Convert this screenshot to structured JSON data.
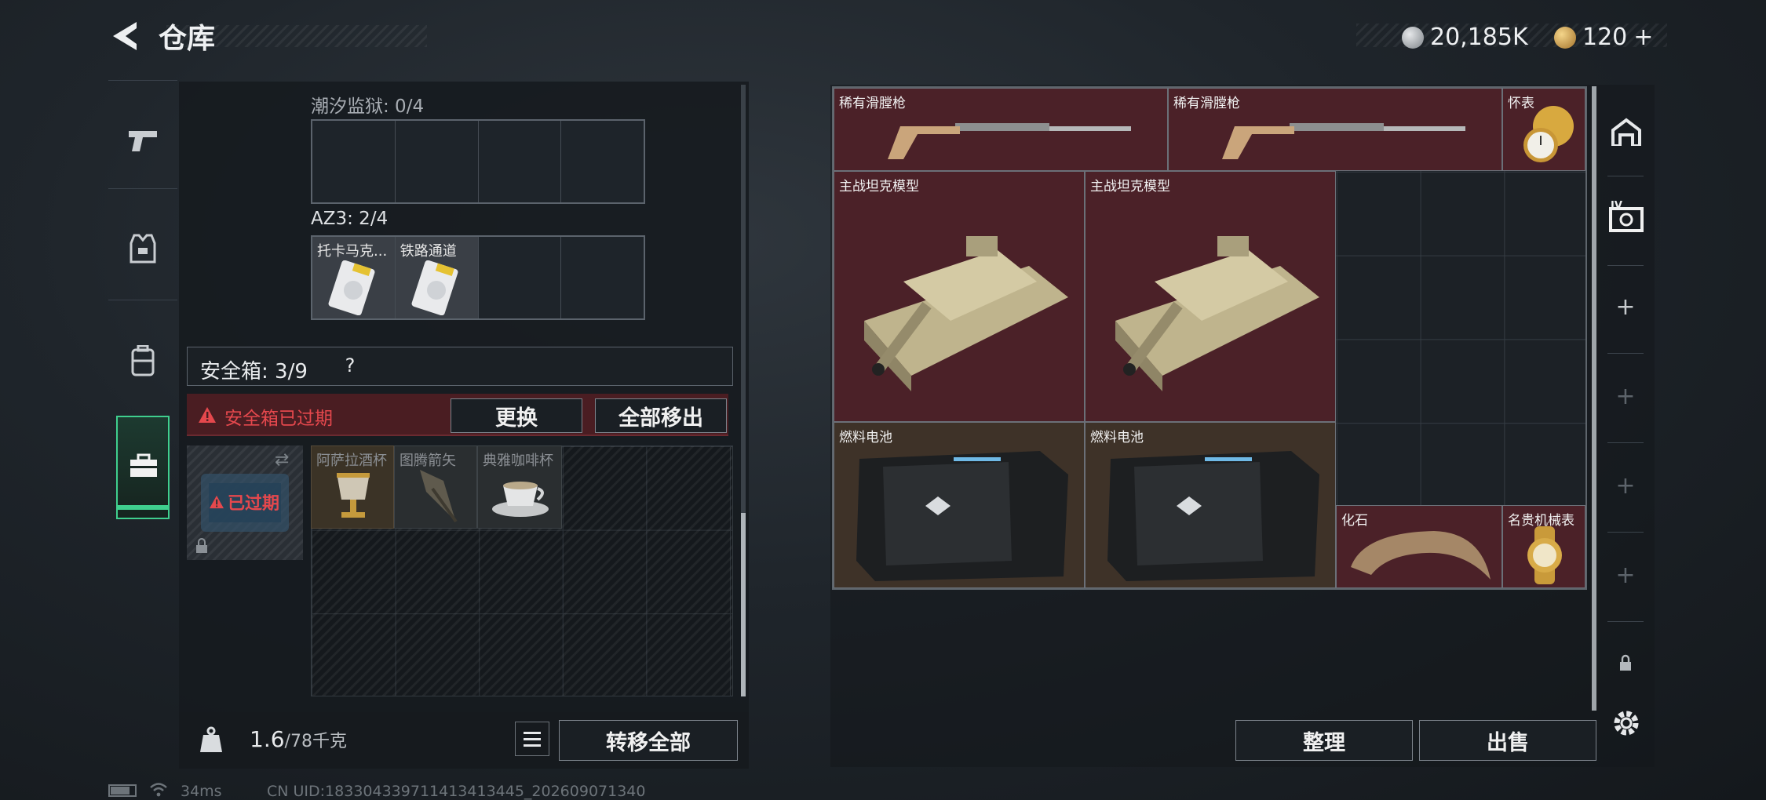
{
  "header": {
    "title": "仓库",
    "silver": "20,185K",
    "gold": "120",
    "gold_plus": "+"
  },
  "containers": [
    {
      "label": "潮汐监狱: 0/4",
      "items": []
    },
    {
      "label": "AZ3: 2/4",
      "items": [
        "托卡马克...",
        "铁路通道"
      ]
    }
  ],
  "safebox": {
    "label": "安全箱: 3/9",
    "help": "?",
    "status": "安全箱已过期",
    "replace_label": "更换",
    "move_all_label": "全部移出",
    "expired_badge": "已过期",
    "items": [
      "阿萨拉酒杯",
      "图腾箭矢",
      "典雅咖啡杯"
    ]
  },
  "footer_left": {
    "weight_value": "1.6",
    "weight_cap": "/78千克",
    "transfer_label": "转移全部",
    "weight_icon_text": "KG"
  },
  "stash_items": [
    {
      "name": "稀有滑膛枪",
      "tone": "red",
      "icon": "musket"
    },
    {
      "name": "稀有滑膛枪",
      "tone": "red",
      "icon": "musket"
    },
    {
      "name": "怀表",
      "tone": "red",
      "icon": "pocket-watch"
    },
    {
      "name": "主战坦克模型",
      "tone": "red",
      "icon": "tank"
    },
    {
      "name": "主战坦克模型",
      "tone": "red",
      "icon": "tank"
    },
    {
      "name": "燃料电池",
      "tone": "brown",
      "icon": "battery"
    },
    {
      "name": "燃料电池",
      "tone": "brown",
      "icon": "battery"
    },
    {
      "name": "化石",
      "tone": "red",
      "icon": "fossil-claw"
    },
    {
      "name": "名贵机械表",
      "tone": "red",
      "icon": "wrist-watch"
    }
  ],
  "footer_right": {
    "sort_label": "整理",
    "sell_label": "出售"
  },
  "status_bar": {
    "ping": "34ms",
    "uid": "CN UID:18330433971141341344​5_202609071340"
  },
  "side_tabs": [
    "weapon",
    "armor",
    "backpack",
    "safebox"
  ],
  "colors": {
    "accent_green": "#3fcf8e",
    "warn_red": "#e5484d",
    "item_red": "#4b2128",
    "item_brown": "#3e3228"
  }
}
